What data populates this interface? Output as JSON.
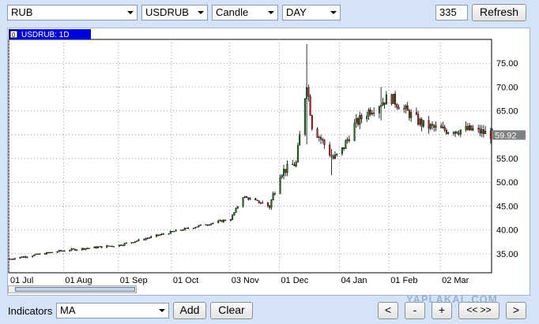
{
  "toolbar": {
    "market": "RUB",
    "symbol": "USDRUB",
    "chart_type": "Candle",
    "period": "DAY",
    "bars": "335",
    "refresh_label": "Refresh"
  },
  "chart_panel": {
    "tag_icon": "0",
    "tag_label": "USDRUB: 1D",
    "current_price": "59.92"
  },
  "bottom": {
    "indicators_label": "Indicators",
    "indicator_value": "MA",
    "add_label": "Add",
    "clear_label": "Clear",
    "nav_prev": "<",
    "nav_zoom_out": "-",
    "nav_zoom_in": "+",
    "nav_fit": "<< >>",
    "nav_next": ">"
  },
  "watermark": "YAPLAKAL.COM",
  "colors": {
    "up": "#1f7a1f",
    "down": "#c81e1e",
    "grid": "#9a9a9a",
    "tag_bg": "#0000dd",
    "price_tag_bg": "#808080"
  },
  "chart_data": {
    "type": "candlestick",
    "title": "USDRUB: 1D",
    "xlabel": "",
    "ylabel": "",
    "ylim": [
      31.0,
      80.0
    ],
    "y_ticks": [
      "35.00",
      "40.00",
      "45.00",
      "50.00",
      "55.00",
      "60.00",
      "65.00",
      "70.00",
      "75.00"
    ],
    "x_tick_labels": [
      "01 Jul",
      "01 Aug",
      "01 Sep",
      "01 Oct",
      "03 Nov",
      "01 Dec",
      "04 Jan",
      "01 Feb",
      "02 Mar"
    ],
    "current_price": 59.92,
    "close_path": [
      [
        "2014-07-01",
        33.9
      ],
      [
        "2014-08-01",
        35.7
      ],
      [
        "2014-09-01",
        36.8
      ],
      [
        "2014-10-01",
        39.6
      ],
      [
        "2014-11-03",
        42.3
      ],
      [
        "2014-11-10",
        47.0
      ],
      [
        "2014-11-25",
        45.0
      ],
      [
        "2014-12-01",
        52.0
      ],
      [
        "2014-12-10",
        54.0
      ],
      [
        "2014-12-16",
        71.0
      ],
      [
        "2014-12-19",
        62.0
      ],
      [
        "2014-12-31",
        55.0
      ],
      [
        "2015-01-04",
        56.0
      ],
      [
        "2015-01-12",
        62.0
      ],
      [
        "2015-01-20",
        65.0
      ],
      [
        "2015-02-01",
        68.0
      ],
      [
        "2015-02-10",
        65.0
      ],
      [
        "2015-02-20",
        62.0
      ],
      [
        "2015-03-02",
        61.0
      ],
      [
        "2015-03-20",
        61.0
      ],
      [
        "2015-03-31",
        59.92
      ]
    ],
    "spikes": [
      [
        "2014-12-16",
        79.0,
        58.0
      ],
      [
        "2014-12-30",
        57.0,
        51.5
      ],
      [
        "2015-02-01",
        71.5,
        63.5
      ],
      [
        "2015-01-27",
        70.0,
        63.0
      ]
    ],
    "grid": true
  }
}
